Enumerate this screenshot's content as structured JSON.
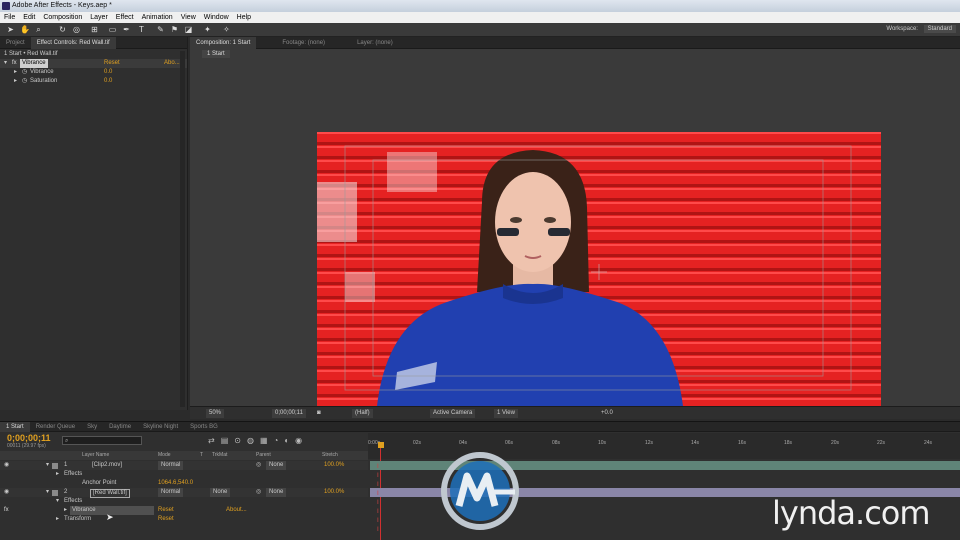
{
  "window": {
    "title": "Adobe After Effects - Keys.aep *"
  },
  "menu": [
    "File",
    "Edit",
    "Composition",
    "Layer",
    "Effect",
    "Animation",
    "View",
    "Window",
    "Help"
  ],
  "workspace": {
    "label": "Workspace:",
    "value": "Standard"
  },
  "left_panel": {
    "tabs": [
      "Project",
      "Effect Controls: Red Wall.tif"
    ],
    "breadcrumb": "1 Start • Red Wall.tif",
    "effect": {
      "name": "Vibrance",
      "reset": "Reset",
      "about": "Abo..."
    },
    "props": [
      {
        "name": "Vibrance",
        "value": "0.0"
      },
      {
        "name": "Saturation",
        "value": "0.0"
      }
    ]
  },
  "viewer": {
    "tabs": [
      "Composition: 1 Start",
      "Footage: (none)",
      "Layer: (none)"
    ],
    "comp_tab": "1 Start",
    "bar": {
      "zoom": "50%",
      "timecode": "0;00;00;11",
      "res": "(Half)",
      "camera": "Active Camera",
      "views": "1 View",
      "exposure": "+0.0"
    }
  },
  "timeline": {
    "tabs": [
      "1 Start",
      "Render Queue",
      "Sky",
      "Daytime",
      "Skyline Night",
      "Sports BG"
    ],
    "timecode": "0;00;00;11",
    "frames": "00011 (29.97 fps)",
    "columns": {
      "layer_name": "Layer Name",
      "mode": "Mode",
      "t": "T",
      "trkmat": "TrkMat",
      "parent": "Parent",
      "stretch": "Stretch"
    },
    "ruler": [
      "0:00s",
      "02s",
      "04s",
      "06s",
      "08s",
      "10s",
      "12s",
      "14s",
      "16s",
      "18s",
      "20s",
      "22s",
      "24s"
    ],
    "layers": [
      {
        "num": "1",
        "name": "[Clip2.mov]",
        "mode": "Normal",
        "trkmat": "",
        "parent": "None",
        "stretch": "100.0%"
      },
      {
        "num": "2",
        "name": "[Red Wall.tif]",
        "mode": "Normal",
        "trkmat": "None",
        "parent": "None",
        "stretch": "100.0%"
      }
    ],
    "sub": {
      "effects": "Effects",
      "anchor_label": "Anchor Point",
      "anchor_value": "1064.6,540.0",
      "effects2": "Effects",
      "vibrance": "Vibrance",
      "reset": "Reset",
      "about": "About...",
      "transform": "Transform",
      "reset2": "Reset"
    }
  },
  "watermark": "lynda.com",
  "colors": {
    "accent": "#e0a020",
    "red_wall": "#e41e1e",
    "shirt": "#2040b0"
  }
}
